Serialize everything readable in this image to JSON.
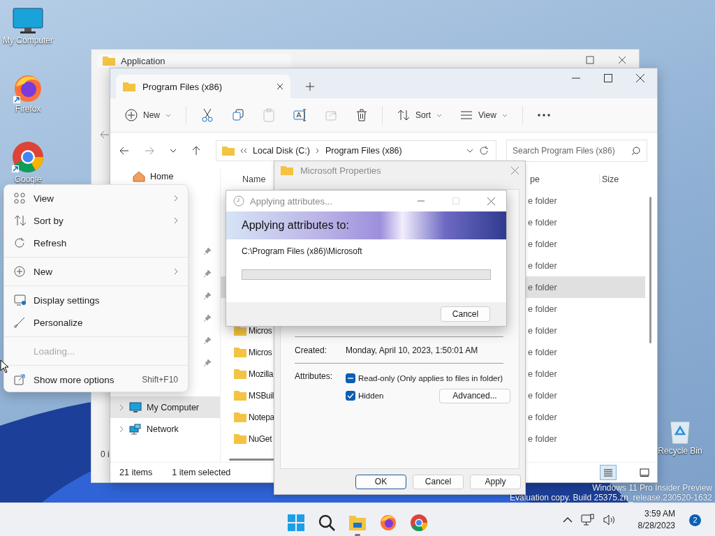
{
  "desktop_icons": [
    {
      "kind": "computer",
      "label": "My Computer"
    },
    {
      "kind": "firefox",
      "label": "Firefox"
    },
    {
      "kind": "chrome",
      "label": "Google"
    },
    {
      "kind": "recycle",
      "label": "Recycle Bin"
    }
  ],
  "back_window": {
    "tab": "Application",
    "status": "0 i"
  },
  "explorer": {
    "tab": "Program Files (x86)",
    "toolbar": [
      {
        "kind": "new",
        "label": "New",
        "disabled": false
      },
      {
        "kind": "cut",
        "disabled": false
      },
      {
        "kind": "copy",
        "disabled": false
      },
      {
        "kind": "paste",
        "disabled": true
      },
      {
        "kind": "rename",
        "disabled": false
      },
      {
        "kind": "share",
        "disabled": true
      },
      {
        "kind": "delete",
        "disabled": false
      },
      {
        "kind": "sort",
        "label": "Sort",
        "disabled": false
      },
      {
        "kind": "view",
        "label": "View",
        "disabled": false
      },
      {
        "kind": "more",
        "disabled": false
      }
    ],
    "address": [
      "Local Disk (C:)",
      "Program Files (x86)"
    ],
    "search": {
      "placeholder": "Search Program Files (x86)"
    },
    "nav": [
      {
        "kind": "home",
        "label": "Home",
        "selected": false
      },
      {
        "kind": "pinned",
        "pinned": true
      },
      {
        "kind": "pinned",
        "pinned": true
      },
      {
        "kind": "pinned",
        "pinned": true
      },
      {
        "kind": "pinned",
        "pinned": true
      },
      {
        "kind": "pinned",
        "pinned": true
      },
      {
        "kind": "pinned",
        "pinned": true
      },
      {
        "kind": "computer",
        "label": "My Computer",
        "selected": true,
        "expanded": false
      },
      {
        "kind": "network",
        "label": "Network",
        "selected": false,
        "expanded": false
      }
    ],
    "columns": [
      "Name",
      "pe",
      "Size"
    ],
    "rows": [
      {
        "type": "e folder",
        "selected": false
      },
      {
        "type": "e folder",
        "selected": false
      },
      {
        "type": "e folder",
        "selected": false
      },
      {
        "type": "e folder",
        "selected": false
      },
      {
        "type": "e folder",
        "selected": true
      },
      {
        "type": "e folder",
        "selected": false
      },
      {
        "name": "Micros",
        "type": "e folder",
        "selected": false
      },
      {
        "name": "Micros",
        "type": "e folder",
        "selected": false
      },
      {
        "name": "Mozilla",
        "type": "e folder",
        "selected": false
      },
      {
        "name": "MSBuil",
        "type": "e folder",
        "selected": false
      },
      {
        "name": "Notepa",
        "type": "e folder",
        "selected": false
      },
      {
        "name": "NuGet",
        "type": "e folder",
        "selected": false
      }
    ],
    "status": {
      "count": "21 items",
      "selection": "1 item selected"
    },
    "view_modes": [
      {
        "kind": "details",
        "selected": true
      },
      {
        "kind": "tiles",
        "selected": false
      }
    ]
  },
  "properties": {
    "title": "Microsoft Properties",
    "fields": [
      {
        "label": "Created:",
        "value": "Monday, April 10, 2023, 1:50:01 AM"
      }
    ],
    "attributes_label": "Attributes:",
    "attributes": [
      {
        "label": "Read-only (Only applies to files in folder)",
        "checked": true,
        "indeterminate": true
      },
      {
        "label": "Hidden",
        "checked": true,
        "indeterminate": false
      }
    ],
    "advanced": "Advanced...",
    "buttons": [
      {
        "label": "OK",
        "default": true
      },
      {
        "label": "Cancel",
        "default": false
      },
      {
        "label": "Apply",
        "default": false
      }
    ]
  },
  "progress_dialog": {
    "title": "Applying attributes...",
    "heading": "Applying attributes to:",
    "path": "C:\\Program Files (x86)\\Microsoft",
    "level": 0,
    "button": "Cancel"
  },
  "context_menu": [
    {
      "kind": "view",
      "label": "View",
      "submenu": true,
      "disabled": false
    },
    {
      "kind": "sort",
      "label": "Sort by",
      "submenu": true,
      "disabled": false
    },
    {
      "kind": "refresh",
      "label": "Refresh",
      "submenu": false,
      "disabled": false
    },
    {
      "kind": "separator"
    },
    {
      "kind": "new",
      "label": "New",
      "submenu": true,
      "disabled": false
    },
    {
      "kind": "separator"
    },
    {
      "kind": "display",
      "label": "Display settings",
      "submenu": false,
      "disabled": false
    },
    {
      "kind": "personalize",
      "label": "Personalize",
      "submenu": false,
      "disabled": false
    },
    {
      "kind": "separator"
    },
    {
      "kind": "loading",
      "label": "Loading...",
      "submenu": false,
      "disabled": true
    },
    {
      "kind": "separator"
    },
    {
      "kind": "more_options",
      "label": "Show more options",
      "shortcut": "Shift+F10",
      "submenu": false,
      "disabled": false
    }
  ],
  "watermark": [
    "Windows 11 Pro Insider Preview",
    "Evaluation copy. Build 25375.zn_release.230520-1632"
  ],
  "taskbar": {
    "apps": [
      {
        "kind": "start",
        "running": false
      },
      {
        "kind": "search",
        "running": false
      },
      {
        "kind": "explorer",
        "running": true
      },
      {
        "kind": "firefox",
        "running": false
      },
      {
        "kind": "chrome",
        "running": false
      }
    ],
    "time": "3:59 AM",
    "date": "8/28/2023",
    "notifications": "2"
  }
}
